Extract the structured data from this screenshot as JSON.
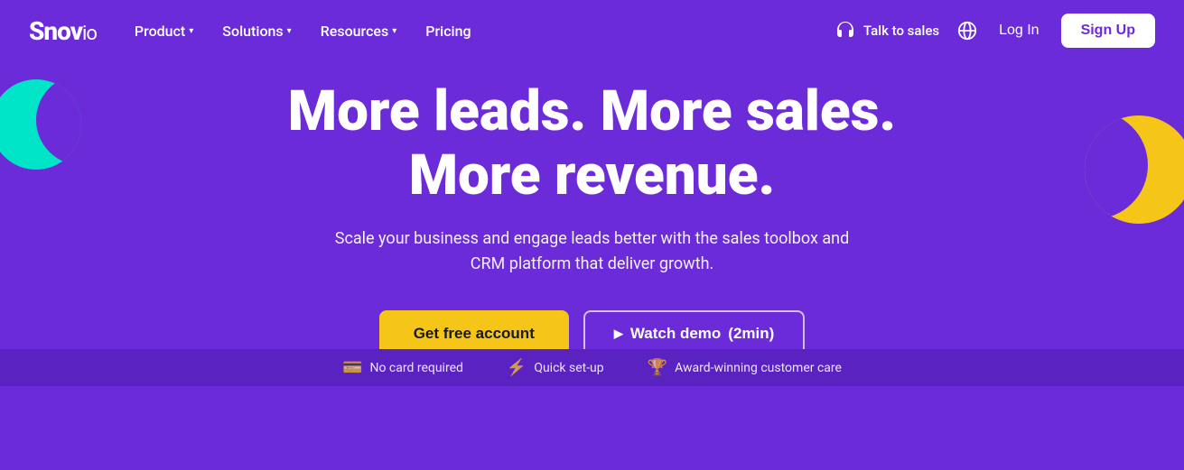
{
  "logo": {
    "snov": "Snov",
    "io": "io"
  },
  "navbar": {
    "product_label": "Product",
    "solutions_label": "Solutions",
    "resources_label": "Resources",
    "pricing_label": "Pricing",
    "talk_to_sales_label": "Talk to sales",
    "login_label": "Log In",
    "signup_label": "Sign Up"
  },
  "hero": {
    "title_line1": "More leads. More sales.",
    "title_line2": "More revenue.",
    "subtitle": "Scale your business and engage leads better with the sales toolbox and CRM platform that deliver growth.",
    "cta_primary": "Get free account",
    "cta_secondary_prefix": "Watch demo",
    "cta_secondary_duration": "(2min)"
  },
  "trust": {
    "item1": "No card required",
    "item2": "Quick set-up",
    "item3": "Award-winning customer care"
  }
}
